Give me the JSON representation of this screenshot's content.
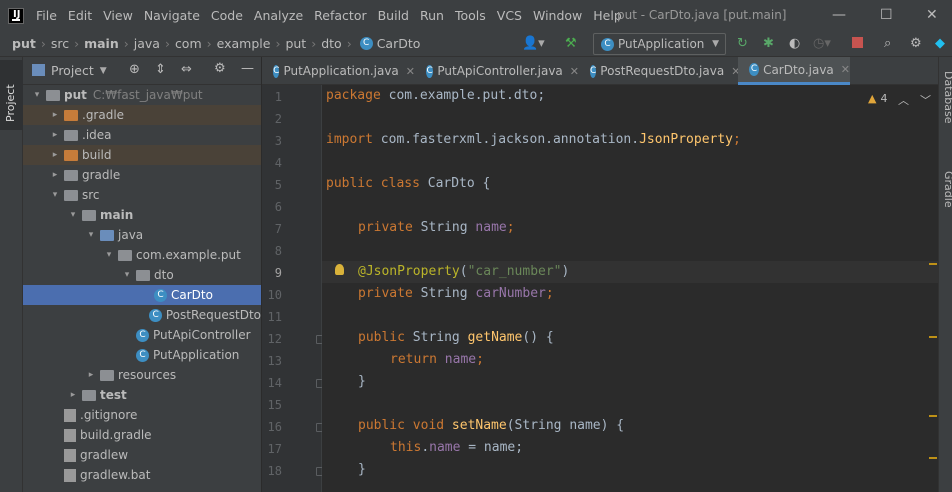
{
  "window": {
    "title": "put - CarDto.java [put.main]",
    "menu": [
      "File",
      "Edit",
      "View",
      "Navigate",
      "Code",
      "Analyze",
      "Refactor",
      "Build",
      "Run",
      "Tools",
      "VCS",
      "Window",
      "Help"
    ],
    "minimize": "—",
    "maximize": "☐",
    "close": "✕"
  },
  "breadcrumb": [
    "put",
    "src",
    "main",
    "java",
    "com",
    "example",
    "put",
    "dto",
    "CarDto"
  ],
  "toolbar": {
    "run_config": "PutApplication"
  },
  "project": {
    "tool_window": "Project",
    "header": "Project",
    "tree": [
      {
        "label": "put",
        "extra": "C:₩fast_java₩put",
        "depth": 0,
        "arrow": "▾",
        "icon": "grey",
        "bold": true
      },
      {
        "label": ".gradle",
        "depth": 1,
        "arrow": "▸",
        "icon": "orange",
        "excluded": true
      },
      {
        "label": ".idea",
        "depth": 1,
        "arrow": "▸",
        "icon": "grey"
      },
      {
        "label": "build",
        "depth": 1,
        "arrow": "▸",
        "icon": "orange",
        "excluded": true
      },
      {
        "label": "gradle",
        "depth": 1,
        "arrow": "▸",
        "icon": "grey"
      },
      {
        "label": "src",
        "depth": 1,
        "arrow": "▾",
        "icon": "grey"
      },
      {
        "label": "main",
        "depth": 2,
        "arrow": "▾",
        "icon": "grey",
        "bold": true
      },
      {
        "label": "java",
        "depth": 3,
        "arrow": "▾",
        "icon": "blue"
      },
      {
        "label": "com.example.put",
        "depth": 4,
        "arrow": "▾",
        "icon": "grey"
      },
      {
        "label": "dto",
        "depth": 5,
        "arrow": "▾",
        "icon": "grey"
      },
      {
        "label": "CarDto",
        "depth": 6,
        "arrow": "",
        "icon": "class",
        "selected": true
      },
      {
        "label": "PostRequestDto",
        "depth": 6,
        "arrow": "",
        "icon": "class"
      },
      {
        "label": "PutApiController",
        "depth": 5,
        "arrow": "",
        "icon": "class"
      },
      {
        "label": "PutApplication",
        "depth": 5,
        "arrow": "",
        "icon": "class"
      },
      {
        "label": "resources",
        "depth": 3,
        "arrow": "▸",
        "icon": "grey"
      },
      {
        "label": "test",
        "depth": 2,
        "arrow": "▸",
        "icon": "grey",
        "bold": true
      },
      {
        "label": ".gitignore",
        "depth": 1,
        "arrow": "",
        "icon": "file"
      },
      {
        "label": "build.gradle",
        "depth": 1,
        "arrow": "",
        "icon": "file"
      },
      {
        "label": "gradlew",
        "depth": 1,
        "arrow": "",
        "icon": "file"
      },
      {
        "label": "gradlew.bat",
        "depth": 1,
        "arrow": "",
        "icon": "file"
      }
    ]
  },
  "tabs": [
    {
      "label": "PutApplication.java",
      "active": false
    },
    {
      "label": "PutApiController.java",
      "active": false
    },
    {
      "label": "PostRequestDto.java",
      "active": false
    },
    {
      "label": "CarDto.java",
      "active": true
    }
  ],
  "editor": {
    "warnings": "4",
    "lines": [
      "1",
      "2",
      "3",
      "4",
      "5",
      "6",
      "7",
      "8",
      "9",
      "10",
      "11",
      "12",
      "13",
      "14",
      "15",
      "16",
      "17",
      "18"
    ],
    "code": {
      "l1_kw": "package",
      "l1_rest": " com.example.put.dto;",
      "l3_kw": "import",
      "l3_rest": " com.fasterxml.jackson.annotation.",
      "l3_cls": "JsonProperty",
      "l3_end": ";",
      "l5_kw": "public class",
      "l5_rest": " CarDto {",
      "l7_kw": "private",
      "l7_type": " String ",
      "l7_fd": "name",
      "l7_end": ";",
      "l9_an": "@JsonProperty",
      "l9_p1": "(",
      "l9_st": "\"car_number\"",
      "l9_p2": ")",
      "l10_kw": "private",
      "l10_type": " String ",
      "l10_fd": "carNumber",
      "l10_end": ";",
      "l12_kw": "public",
      "l12_type": " String ",
      "l12_fn": "getName",
      "l12_end": "() {",
      "l13_kw": "return",
      "l13_sp": " ",
      "l13_fd": "name",
      "l13_end": ";",
      "l14": "}",
      "l16_kw": "public void",
      "l16_sp": " ",
      "l16_fn": "setName",
      "l16_end": "(String name) {",
      "l17_kw": "this",
      "l17_dot": ".",
      "l17_fd": "name",
      "l17_end": " = name;",
      "l18": "}"
    }
  },
  "right_tools": [
    "Database",
    "Gradle"
  ]
}
